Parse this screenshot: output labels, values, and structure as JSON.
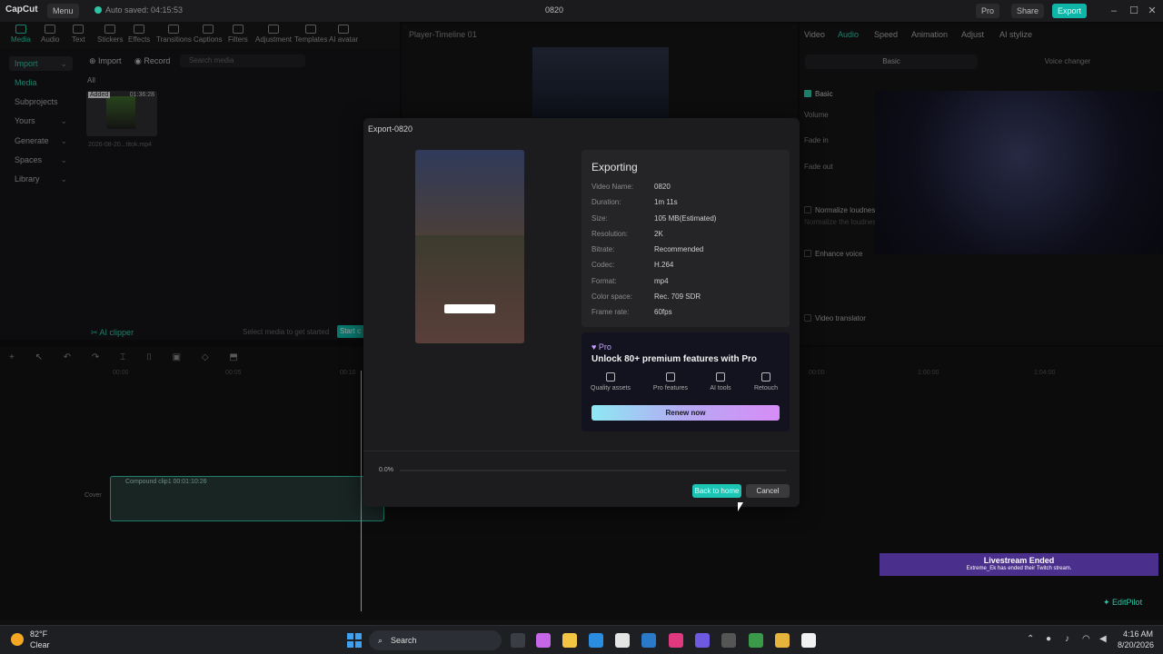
{
  "app": {
    "logo": "CapCut",
    "menu_label": "Menu",
    "autosave": "Auto saved: 04:15:53",
    "project_name": "0820",
    "pro_label": "Pro",
    "share_label": "Share",
    "export_label": "Export",
    "accent_color": "#2dc4a5"
  },
  "toolbar": {
    "tools": [
      "Media",
      "Audio",
      "Text",
      "Stickers",
      "Effects",
      "Transitions",
      "Captions",
      "Filters",
      "Adjustment",
      "Templates",
      "AI avatar"
    ]
  },
  "leftnav": {
    "items": [
      "Import",
      "Media",
      "Subprojects",
      "Yours",
      "Generate",
      "Spaces",
      "Library"
    ]
  },
  "media": {
    "import_label": "Import",
    "record_label": "Record",
    "search_placeholder": "Search media",
    "filter_all": "All",
    "added_badge": "Added",
    "duration": "01:36:28",
    "filename": "2026-08-20...titok.mp4",
    "ai_clipper": "AI clipper",
    "select_hint": "Select media to get started",
    "start_label": "Start c"
  },
  "player": {
    "title": "Player-Timeline 01"
  },
  "inspector": {
    "tabs": [
      "Video",
      "Audio",
      "Speed",
      "Animation",
      "Adjust",
      "AI stylize"
    ],
    "active_tab": "Audio",
    "sub_basic": "Basic",
    "sub_voice": "Voice changer",
    "basic_label": "Basic",
    "volume": "Volume",
    "fade_in": "Fade in",
    "fade_out": "Fade out",
    "normalize": "Normalize loudnes",
    "normalize_sub": "Normalize the loudnes",
    "enhance": "Enhance voice",
    "translator": "Video translator"
  },
  "timeline": {
    "ticks": [
      "00:00",
      "00:05",
      "00:10"
    ],
    "right_ticks": [
      "00:00",
      "1:00:00",
      "1:04:00"
    ],
    "clip_label": "Compound clip1  00:01:10:26",
    "cover_label": "Cover"
  },
  "export_modal": {
    "title": "Export-0820",
    "heading": "Exporting",
    "rows": [
      {
        "key": "Video Name:",
        "value": "0820"
      },
      {
        "key": "Duration:",
        "value": "1m 11s"
      },
      {
        "key": "Size:",
        "value": "105 MB(Estimated)"
      },
      {
        "key": "Resolution:",
        "value": "2K"
      },
      {
        "key": "Bitrate:",
        "value": "Recommended"
      },
      {
        "key": "Codec:",
        "value": "H.264"
      },
      {
        "key": "Format:",
        "value": "mp4"
      },
      {
        "key": "Color space:",
        "value": "Rec. 709 SDR"
      },
      {
        "key": "Frame rate:",
        "value": "60fps"
      }
    ],
    "pro_label": "Pro",
    "pro_headline": "Unlock 80+ premium features with Pro",
    "pro_features": [
      "Quality assets",
      "Pro features",
      "AI tools",
      "Retouch"
    ],
    "renew_label": "Renew now",
    "progress_text": "0.0%",
    "progress_value": 0.0,
    "back_home_label": "Back to home",
    "cancel_label": "Cancel"
  },
  "toast": {
    "title": "Livestream Ended",
    "subtitle": "Extreme_Ek has ended their Twitch stream."
  },
  "editpilot": "EditPilot",
  "taskbar": {
    "temp": "82°F",
    "weather": "Clear",
    "search": "Search",
    "time": "4:16 AM",
    "date": "8/20/2026"
  }
}
